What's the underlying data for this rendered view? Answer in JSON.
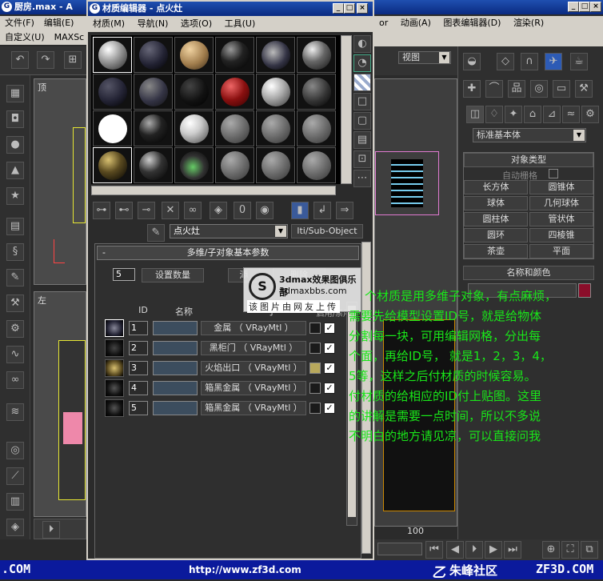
{
  "main_window": {
    "title": "厨房.max - A",
    "menu": [
      "文件(F)",
      "编辑(E)",
      "自定义(U)",
      "MAXSc"
    ],
    "right_menu": [
      "or",
      "动画(A)",
      "图表编辑器(D)",
      "渲染(R)"
    ],
    "view_dropdown": "视图",
    "viewport_top_label": "顶",
    "viewport_left_label": "左",
    "ruler_value": "100"
  },
  "command_panel": {
    "category_dropdown": "标准基本体",
    "object_type_header": "对象类型",
    "autogrid_label": "自动栅格",
    "buttons": [
      [
        "长方体",
        "圆锥体"
      ],
      [
        "球体",
        "几何球体"
      ],
      [
        "圆柱体",
        "管状体"
      ],
      [
        "圆环",
        "四棱锥"
      ],
      [
        "茶壶",
        "平面"
      ]
    ],
    "name_color_header": "名称和颜色"
  },
  "material_editor": {
    "title": "材质编辑器 - 点火灶",
    "menu": [
      "材质(M)",
      "导航(N)",
      "选项(O)",
      "工具(U)"
    ],
    "material_name": "点火灶",
    "material_type": "lti/Sub-Object",
    "rollout_title": "多维/子对象基本参数",
    "count_value": "5",
    "set_count_button": "设置数量",
    "add_button": "添",
    "delete_button": "删除",
    "col_id": "ID",
    "col_name": "名称",
    "col_sub": "子",
    "col_onoff": "启用/禁用",
    "rows": [
      {
        "id": "1",
        "material": "金属 （ VRayMtl ）",
        "color": "#1a1a1a",
        "enabled": "✓"
      },
      {
        "id": "2",
        "material": "黑柜门 （ VRayMtl ）",
        "color": "#1a1a1a",
        "enabled": "✓"
      },
      {
        "id": "3",
        "material": "火焰出口 （ VRayMtl ）",
        "color": "#b8a85c",
        "enabled": "✓"
      },
      {
        "id": "4",
        "material": "箱黑金属 （ VRayMtl ）",
        "color": "#1a1a1a",
        "enabled": "✓"
      },
      {
        "id": "5",
        "material": "箱黑金属 （ VRayMtl ）",
        "color": "#1a1a1a",
        "enabled": "✓"
      }
    ],
    "dropdown_arrow": "▼"
  },
  "watermark": {
    "site": "3dmax效果图俱乐部",
    "url": "3dmaxbbs.com",
    "caption": "该图片由网友上传"
  },
  "annotation_lines": [
    "个材质是用多维子对象，有点麻烦，",
    "需要先给模型设置ID号，就是给物体",
    "分割每一块，可用编辑网格，分出每",
    "个面，再给ID号， 就是1，2，3，4，",
    "5等，这样之后付材质的时候容易。",
    "付材质的给相应的ID付上贴图。这里",
    "的讲解是需要一点时间，所以不多说",
    "不明白的地方请见凉，可以直接问我"
  ],
  "footer": {
    "left": ".COM",
    "center": "http://www.zf3d.com",
    "brand": "朱峰社区",
    "right": "ZF3D.COM"
  },
  "colors": {
    "annotation": "#19e619",
    "title_bar": "#0a2a80",
    "footer": "#0b1a9c"
  }
}
